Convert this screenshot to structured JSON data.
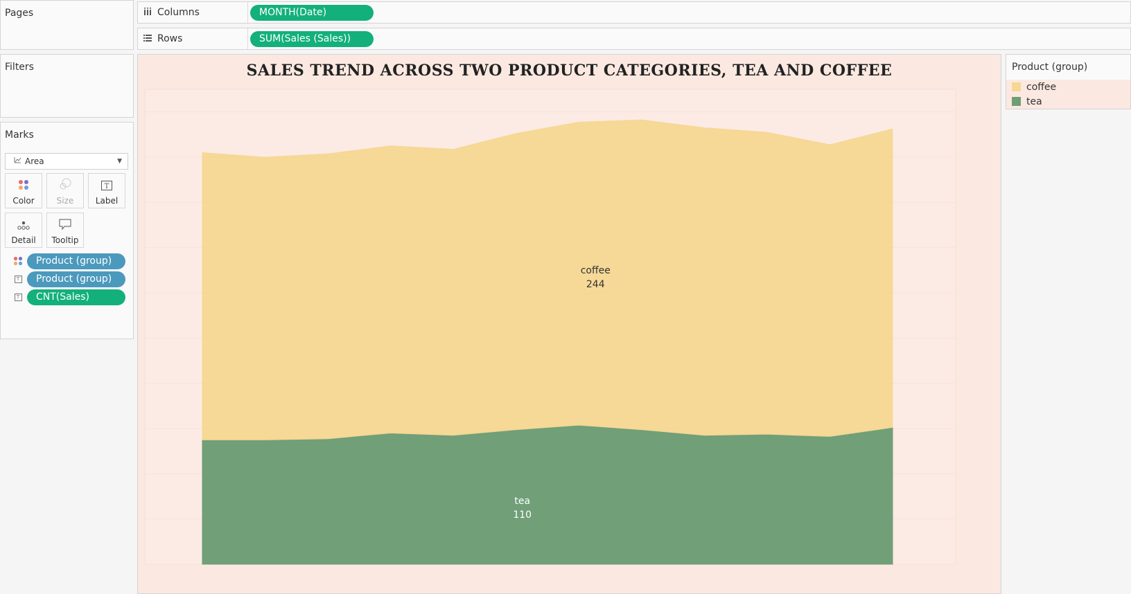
{
  "pages": {
    "title": "Pages"
  },
  "filters": {
    "title": "Filters"
  },
  "marks": {
    "title": "Marks",
    "mark_type": "Area",
    "tiles": [
      {
        "label": "Color",
        "icon": "color-dots-icon"
      },
      {
        "label": "Size",
        "icon": "size-circles-icon"
      },
      {
        "label": "Label",
        "icon": "label-t-icon"
      },
      {
        "label": "Detail",
        "icon": "detail-dots-icon"
      },
      {
        "label": "Tooltip",
        "icon": "tooltip-bubble-icon"
      }
    ],
    "fields": [
      {
        "icon": "color-dots-icon",
        "label": "Product (group)"
      },
      {
        "icon": "label-t-icon",
        "label": "Product (group)"
      },
      {
        "icon": "label-t-icon",
        "label": "CNT(Sales)"
      }
    ]
  },
  "shelves": {
    "columns": {
      "label": "Columns",
      "icon": "columns-icon",
      "pill": "MONTH(Date)"
    },
    "rows": {
      "label": "Rows",
      "icon": "rows-icon",
      "pill": "SUM(Sales (Sales))"
    }
  },
  "legend": {
    "title": "Product (group)",
    "items": [
      {
        "label": "coffee",
        "color": "#f6d893"
      },
      {
        "label": "tea",
        "color": "#6e9e76"
      }
    ]
  },
  "chart_data": {
    "type": "area",
    "title": "Sales Trend across two product categories, Tea and Coffee",
    "stacked": true,
    "x": [
      1,
      2,
      3,
      4,
      5,
      6,
      7,
      8,
      9,
      10,
      11,
      12
    ],
    "series": [
      {
        "name": "tea",
        "color": "#6e9e76",
        "values": [
          110,
          110,
          111,
          116,
          114,
          119,
          123,
          119,
          114,
          115,
          113,
          121
        ],
        "label": {
          "text": "tea",
          "value": "110"
        }
      },
      {
        "name": "coffee",
        "color": "#f6d893",
        "values": [
          254,
          250,
          252,
          254,
          253,
          262,
          268,
          274,
          272,
          267,
          258,
          264
        ],
        "label": {
          "text": "coffee",
          "value": "244"
        }
      }
    ],
    "ylim": [
      0,
      420
    ],
    "grid": true,
    "axes_visible": false,
    "background": "#fbe9e1"
  }
}
